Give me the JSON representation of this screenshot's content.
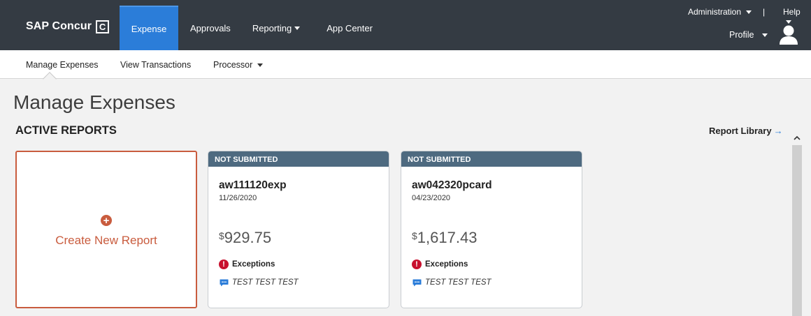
{
  "header": {
    "logo": {
      "text": "SAP Concur",
      "mark": "C"
    },
    "nav": [
      {
        "label": "Expense",
        "active": true
      },
      {
        "label": "Approvals",
        "active": false
      },
      {
        "label": "Reporting",
        "active": false,
        "has_dropdown": true
      },
      {
        "label": "App Center",
        "active": false
      }
    ],
    "administration_label": "Administration",
    "pipe": "|",
    "help_label": "Help",
    "profile_label": "Profile"
  },
  "subnav": [
    {
      "label": "Manage Expenses",
      "active": true
    },
    {
      "label": "View Transactions",
      "active": false
    },
    {
      "label": "Processor",
      "active": false,
      "has_dropdown": true
    }
  ],
  "page": {
    "title": "Manage Expenses",
    "section_title": "ACTIVE REPORTS",
    "report_library_label": "Report Library",
    "report_library_arrow": "→"
  },
  "create_card": {
    "label": "Create New Report",
    "icon": "plus-circle-icon"
  },
  "reports": [
    {
      "status": "NOT SUBMITTED",
      "name": "aw111120exp",
      "date": "11/26/2020",
      "currency_symbol": "$",
      "amount": "929.75",
      "exceptions_label": "Exceptions",
      "comment": "TEST TEST TEST"
    },
    {
      "status": "NOT SUBMITTED",
      "name": "aw042320pcard",
      "date": "04/23/2020",
      "currency_symbol": "$",
      "amount": "1,617.43",
      "exceptions_label": "Exceptions",
      "comment": "TEST TEST TEST"
    }
  ],
  "colors": {
    "topbar": "#343b43",
    "active_nav": "#2b7dd9",
    "create_accent": "#c95c3e",
    "card_header": "#4e6a80",
    "exception_red": "#c8102e",
    "comment_blue": "#2b7dd9"
  }
}
